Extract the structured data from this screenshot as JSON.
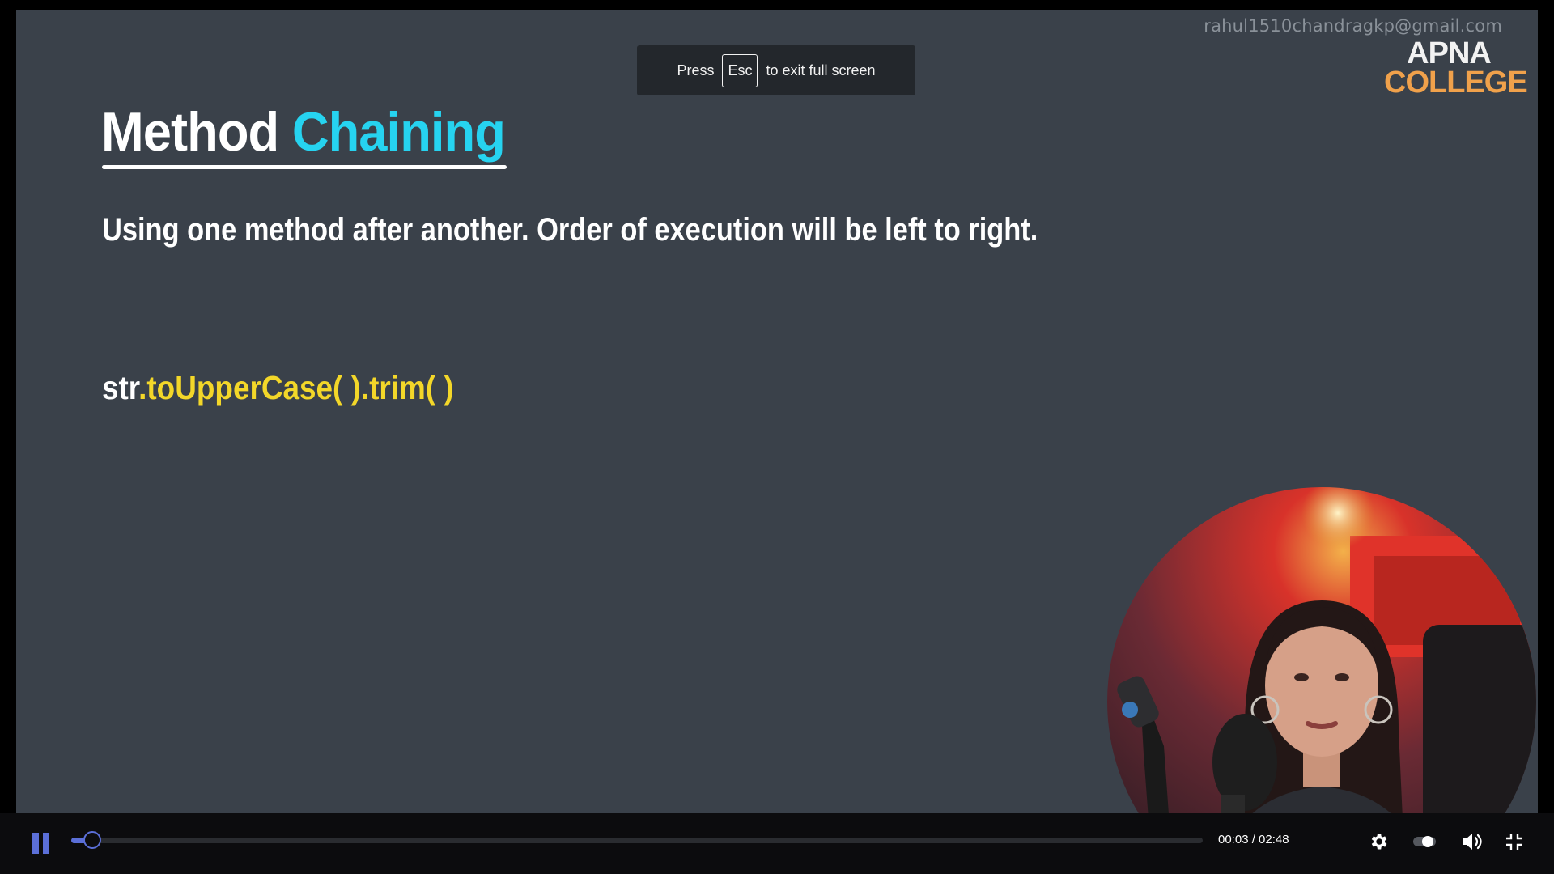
{
  "watermark": "rahul1510chandragkp@gmail.com",
  "logo": {
    "line1": "APNA",
    "line2": "COLLEGE"
  },
  "fullscreen_toast": {
    "before": "Press",
    "key": "Esc",
    "after": "to exit full screen"
  },
  "slide": {
    "title_plain": "Method ",
    "title_accent": "Chaining",
    "subtitle": "Using one method after another. Order of execution will be left to right.",
    "code_object": "str",
    "code_chain": ".toUpperCase( ).trim( )"
  },
  "player": {
    "time_display": "00:03 / 02:48",
    "progress_fraction": 0.018,
    "accent_color": "#5b6fd8",
    "icons": [
      "pause-icon",
      "settings-icon",
      "toggle-icon",
      "volume-icon",
      "exit-fullscreen-icon"
    ]
  }
}
